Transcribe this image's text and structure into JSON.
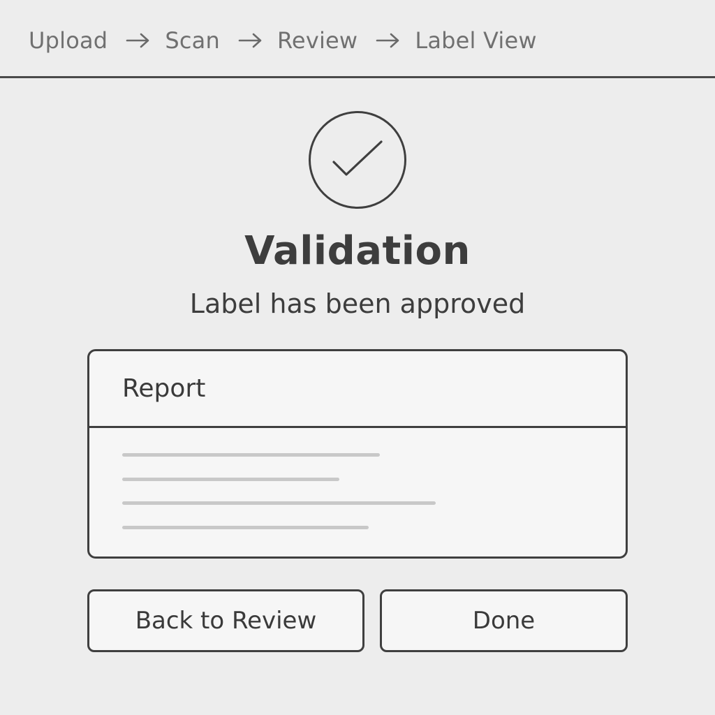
{
  "breadcrumb": {
    "steps": [
      "Upload",
      "Scan",
      "Review",
      "Label View"
    ],
    "separator_icon": "arrow-right-icon"
  },
  "status": {
    "icon": "check-circle-icon",
    "title": "Validation",
    "message": "Label has been approved"
  },
  "report": {
    "title": "Report",
    "placeholder_line_fractions": [
      0.48,
      0.405,
      0.585,
      0.46
    ]
  },
  "actions": {
    "back_label": "Back to Review",
    "done_label": "Done"
  },
  "colors": {
    "background": "#ededed",
    "border": "#3f3f3f",
    "text": "#3d3d3d",
    "muted_text": "#707070",
    "placeholder": "#c8c8c8"
  }
}
